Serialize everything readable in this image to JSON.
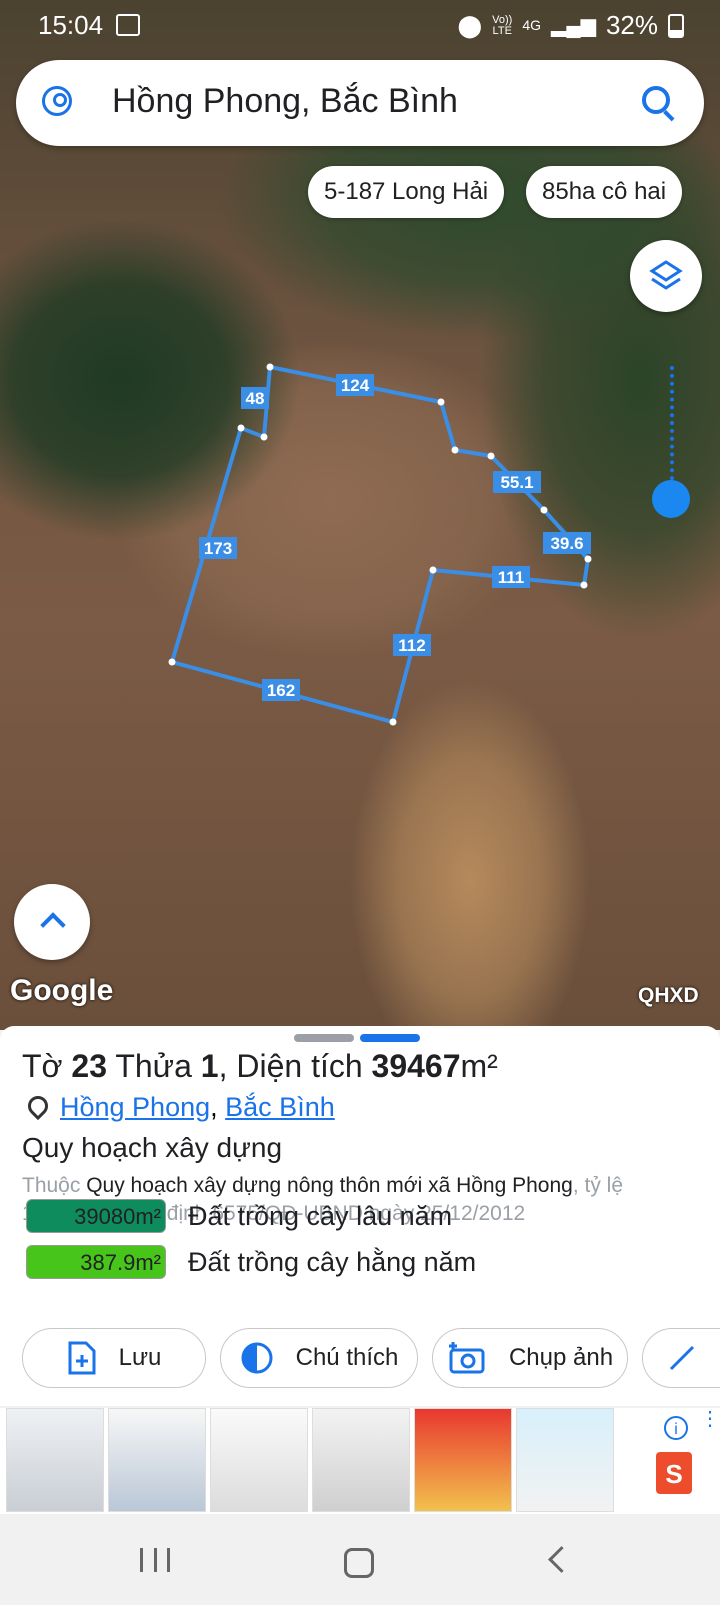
{
  "status_bar": {
    "time": "15:04",
    "network_top": "Vo))",
    "network_bottom": "LTE",
    "data_type": "4G",
    "battery": "32%"
  },
  "search": {
    "query": "Hồng Phong, Bắc Bình"
  },
  "saved_chips": [
    "5-187 Long Hải",
    "85ha cô hai"
  ],
  "plot": {
    "edge_labels": [
      "48",
      "124",
      "55.1",
      "39.6",
      "111",
      "112",
      "162",
      "173"
    ],
    "line_color": "#3a8ee6",
    "label_bg": "#3a8ee6"
  },
  "map": {
    "attribution": "Google",
    "layer_code": "QHXD"
  },
  "parcel": {
    "title_prefix": "Tờ ",
    "sheet_no": "23",
    "title_mid": " Thửa ",
    "parcel_no": "1",
    "title_area_label": ", Diện tích ",
    "area": "39467",
    "area_unit": "m²",
    "commune": "Hồng Phong",
    "separator": ",",
    "district": "Bắc Bình",
    "section_title": "Quy hoạch xây dựng",
    "desc_prefix": "Thuộc ",
    "desc_plan": "Quy hoạch xây dựng nông thôn mới xã Hồng Phong",
    "desc_rest": ", tỷ lệ 1/10000, quyết định 6575/QĐ-UBND ngày 25/12/2012",
    "land_uses": [
      {
        "area": "39080m²",
        "label": "Đất trồng cây lâu năm",
        "color": "#0f8c5e"
      },
      {
        "area": "387.9m²",
        "label": "Đất trồng cây hằng năm",
        "color": "#47c51a"
      }
    ]
  },
  "actions": {
    "save": "Lưu",
    "legend": "Chú thích",
    "photo": "Chụp ảnh"
  },
  "accent": "#1a73e8"
}
